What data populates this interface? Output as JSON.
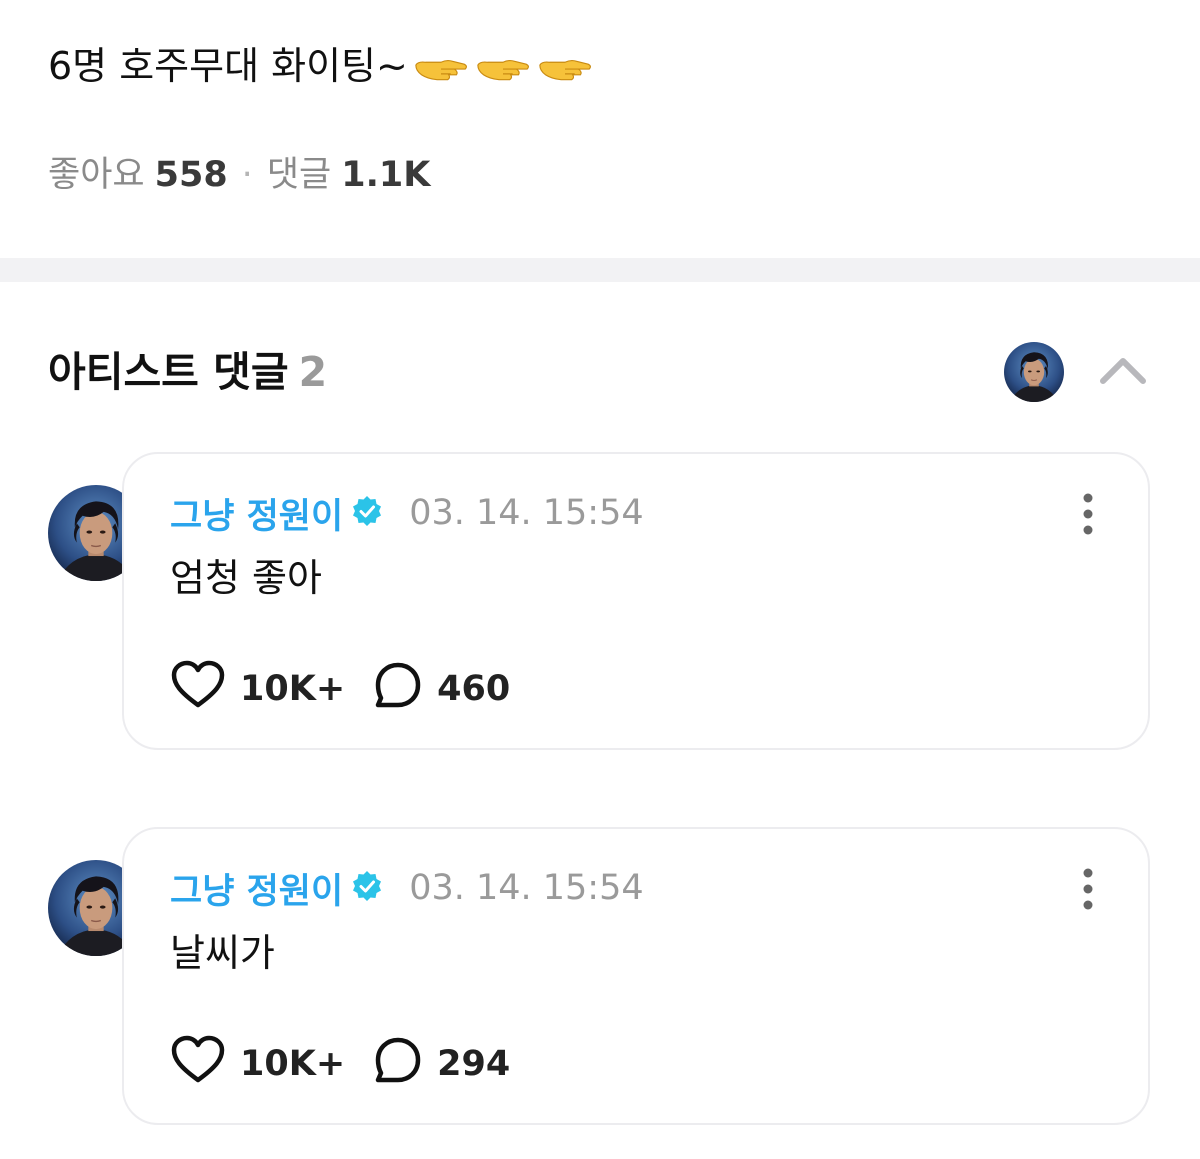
{
  "post": {
    "text": "6명 호주무대 화이팅~",
    "emoji_icon": "backhand-index-pointing-left-icon",
    "emoji_count": 3
  },
  "stats": {
    "likes_label": "좋아요",
    "likes_value": "558",
    "separator": "·",
    "comments_label": "댓글",
    "comments_value": "1.1K"
  },
  "artist_comments": {
    "title": "아티스트 댓글",
    "count": "2",
    "collapse_icon": "chevron-up-icon"
  },
  "comments": [
    {
      "author": "그냥 정원이",
      "verified_icon": "verified-badge-icon",
      "timestamp": "03. 14. 15:54",
      "body": "엄청 좋아",
      "likes": "10K+",
      "replies": "460"
    },
    {
      "author": "그냥 정원이",
      "verified_icon": "verified-badge-icon",
      "timestamp": "03. 14. 15:54",
      "body": "날씨가",
      "likes": "10K+",
      "replies": "294"
    }
  ],
  "colors": {
    "author": "#2aa4ec",
    "verified_badge": "#2bc3e8",
    "muted": "#9a9a9a",
    "divider": "#f2f2f4",
    "card_border": "#ececef"
  }
}
